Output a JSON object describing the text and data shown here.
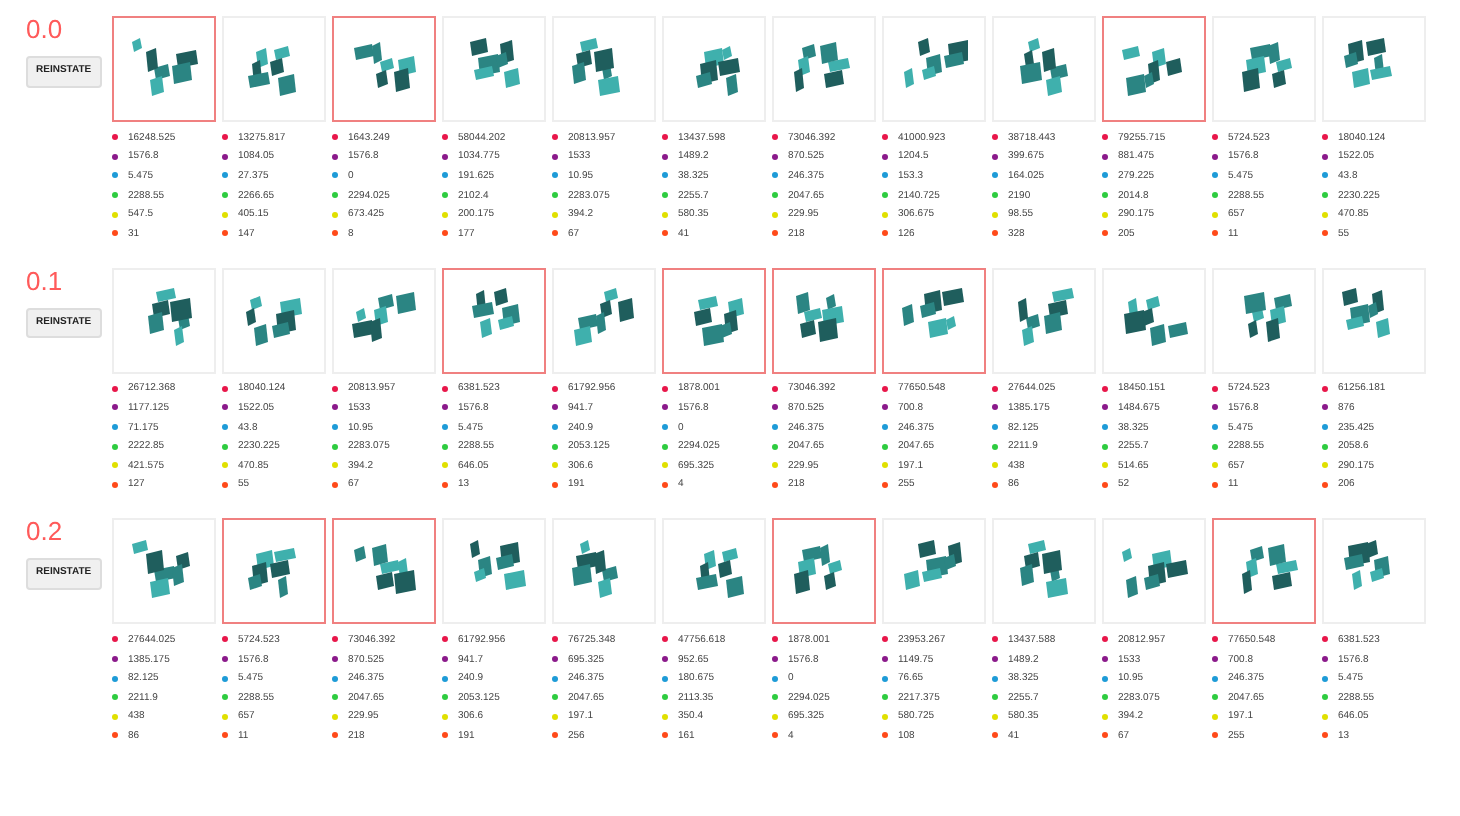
{
  "series": [
    {
      "color": "#e8174a"
    },
    {
      "color": "#8b1a8b"
    },
    {
      "color": "#1e9bd7"
    },
    {
      "color": "#2ecc40"
    },
    {
      "color": "#e0e000"
    },
    {
      "color": "#ff4a1a"
    }
  ],
  "groups": [
    {
      "label": "0.0",
      "button": "REINSTATE",
      "cards": [
        {
          "selected": true,
          "stats": [
            "16248.525",
            "1576.8",
            "5.475",
            "2288.55",
            "547.5",
            "31"
          ]
        },
        {
          "selected": false,
          "stats": [
            "13275.817",
            "1084.05",
            "27.375",
            "2266.65",
            "405.15",
            "147"
          ]
        },
        {
          "selected": true,
          "stats": [
            "1643.249",
            "1576.8",
            "0",
            "2294.025",
            "673.425",
            "8"
          ]
        },
        {
          "selected": false,
          "stats": [
            "58044.202",
            "1034.775",
            "191.625",
            "2102.4",
            "200.175",
            "177"
          ]
        },
        {
          "selected": false,
          "stats": [
            "20813.957",
            "1533",
            "10.95",
            "2283.075",
            "394.2",
            "67"
          ]
        },
        {
          "selected": false,
          "stats": [
            "13437.598",
            "1489.2",
            "38.325",
            "2255.7",
            "580.35",
            "41"
          ]
        },
        {
          "selected": false,
          "stats": [
            "73046.392",
            "870.525",
            "246.375",
            "2047.65",
            "229.95",
            "218"
          ]
        },
        {
          "selected": false,
          "stats": [
            "41000.923",
            "1204.5",
            "153.3",
            "2140.725",
            "306.675",
            "126"
          ]
        },
        {
          "selected": false,
          "stats": [
            "38718.443",
            "399.675",
            "164.025",
            "2190",
            "98.55",
            "328"
          ]
        },
        {
          "selected": true,
          "stats": [
            "79255.715",
            "881.475",
            "279.225",
            "2014.8",
            "290.175",
            "205"
          ]
        },
        {
          "selected": false,
          "stats": [
            "5724.523",
            "1576.8",
            "5.475",
            "2288.55",
            "657",
            "11"
          ]
        },
        {
          "selected": false,
          "stats": [
            "18040.124",
            "1522.05",
            "43.8",
            "2230.225",
            "470.85",
            "55"
          ]
        }
      ]
    },
    {
      "label": "0.1",
      "button": "REINSTATE",
      "cards": [
        {
          "selected": false,
          "stats": [
            "26712.368",
            "1177.125",
            "71.175",
            "2222.85",
            "421.575",
            "127"
          ]
        },
        {
          "selected": false,
          "stats": [
            "18040.124",
            "1522.05",
            "43.8",
            "2230.225",
            "470.85",
            "55"
          ]
        },
        {
          "selected": false,
          "stats": [
            "20813.957",
            "1533",
            "10.95",
            "2283.075",
            "394.2",
            "67"
          ]
        },
        {
          "selected": true,
          "stats": [
            "6381.523",
            "1576.8",
            "5.475",
            "2288.55",
            "646.05",
            "13"
          ]
        },
        {
          "selected": false,
          "stats": [
            "61792.956",
            "941.7",
            "240.9",
            "2053.125",
            "306.6",
            "191"
          ]
        },
        {
          "selected": true,
          "stats": [
            "1878.001",
            "1576.8",
            "0",
            "2294.025",
            "695.325",
            "4"
          ]
        },
        {
          "selected": true,
          "stats": [
            "73046.392",
            "870.525",
            "246.375",
            "2047.65",
            "229.95",
            "218"
          ]
        },
        {
          "selected": true,
          "stats": [
            "77650.548",
            "700.8",
            "246.375",
            "2047.65",
            "197.1",
            "255"
          ]
        },
        {
          "selected": false,
          "stats": [
            "27644.025",
            "1385.175",
            "82.125",
            "2211.9",
            "438",
            "86"
          ]
        },
        {
          "selected": false,
          "stats": [
            "18450.151",
            "1484.675",
            "38.325",
            "2255.7",
            "514.65",
            "52"
          ]
        },
        {
          "selected": false,
          "stats": [
            "5724.523",
            "1576.8",
            "5.475",
            "2288.55",
            "657",
            "11"
          ]
        },
        {
          "selected": false,
          "stats": [
            "61256.181",
            "876",
            "235.425",
            "2058.6",
            "290.175",
            "206"
          ]
        }
      ]
    },
    {
      "label": "0.2",
      "button": "REINSTATE",
      "cards": [
        {
          "selected": false,
          "stats": [
            "27644.025",
            "1385.175",
            "82.125",
            "2211.9",
            "438",
            "86"
          ]
        },
        {
          "selected": true,
          "stats": [
            "5724.523",
            "1576.8",
            "5.475",
            "2288.55",
            "657",
            "11"
          ]
        },
        {
          "selected": true,
          "stats": [
            "73046.392",
            "870.525",
            "246.375",
            "2047.65",
            "229.95",
            "218"
          ]
        },
        {
          "selected": false,
          "stats": [
            "61792.956",
            "941.7",
            "240.9",
            "2053.125",
            "306.6",
            "191"
          ]
        },
        {
          "selected": false,
          "stats": [
            "76725.348",
            "695.325",
            "246.375",
            "2047.65",
            "197.1",
            "256"
          ]
        },
        {
          "selected": false,
          "stats": [
            "47756.618",
            "952.65",
            "180.675",
            "2113.35",
            "350.4",
            "161"
          ]
        },
        {
          "selected": true,
          "stats": [
            "1878.001",
            "1576.8",
            "0",
            "2294.025",
            "695.325",
            "4"
          ]
        },
        {
          "selected": false,
          "stats": [
            "23953.267",
            "1149.75",
            "76.65",
            "2217.375",
            "580.725",
            "108"
          ]
        },
        {
          "selected": false,
          "stats": [
            "13437.588",
            "1489.2",
            "38.325",
            "2255.7",
            "580.35",
            "41"
          ]
        },
        {
          "selected": false,
          "stats": [
            "20812.957",
            "1533",
            "10.95",
            "2283.075",
            "394.2",
            "67"
          ]
        },
        {
          "selected": true,
          "stats": [
            "77650.548",
            "700.8",
            "246.375",
            "2047.65",
            "197.1",
            "255"
          ]
        },
        {
          "selected": false,
          "stats": [
            "6381.523",
            "1576.8",
            "5.475",
            "2288.55",
            "646.05",
            "13"
          ]
        }
      ]
    }
  ]
}
